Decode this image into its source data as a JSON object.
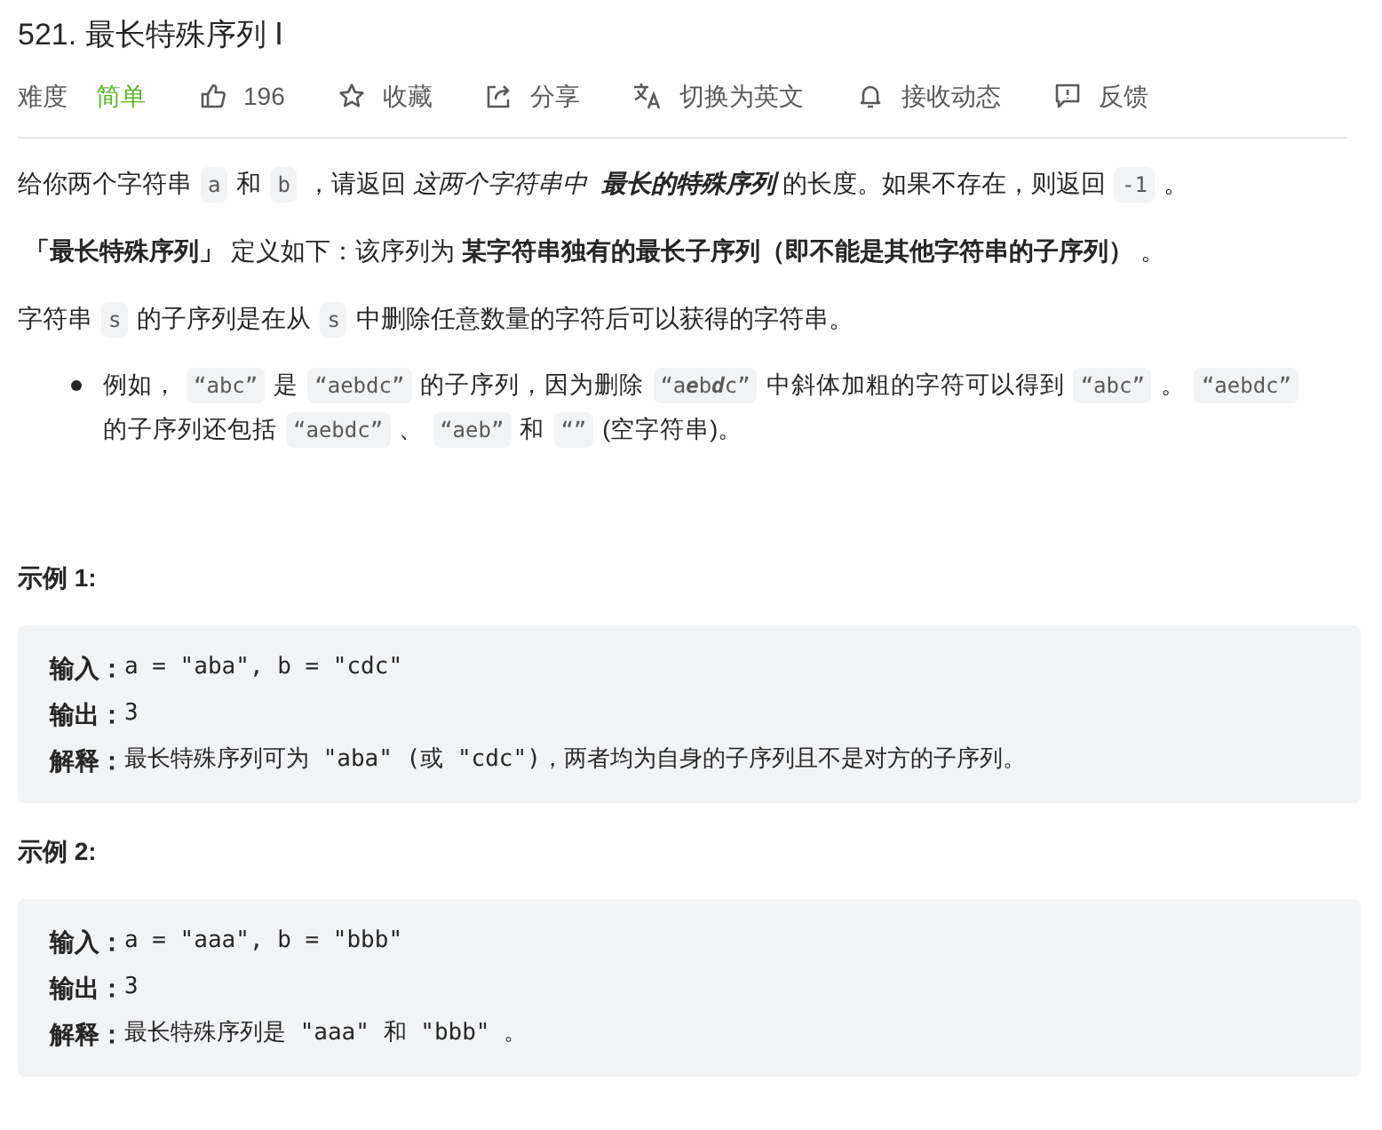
{
  "title": "521. 最长特殊序列 Ⅰ",
  "meta": {
    "difficulty_label": "难度",
    "difficulty": "简单",
    "actions": [
      {
        "kind": "like",
        "label": "196"
      },
      {
        "kind": "star",
        "label": "收藏"
      },
      {
        "kind": "share",
        "label": "分享"
      },
      {
        "kind": "translate",
        "label": "切换为英文"
      },
      {
        "kind": "bell",
        "label": "接收动态"
      },
      {
        "kind": "feedback",
        "label": "反馈"
      }
    ]
  },
  "paragraphs": [
    {
      "segments": [
        {
          "kind": "text",
          "text": "给你两个字符串"
        },
        {
          "kind": "code",
          "text": "a"
        },
        {
          "kind": "text",
          "text": "和"
        },
        {
          "kind": "code",
          "text": "b"
        },
        {
          "kind": "text",
          "text": "，请返回"
        },
        {
          "kind": "italic",
          "text": "这两个字符串中"
        },
        {
          "kind": "bold_italic",
          "text": "最长的特殊序列"
        },
        {
          "kind": "text",
          "text": "的长度。如果不存在，则返回"
        },
        {
          "kind": "code",
          "text": "-1"
        },
        {
          "kind": "text",
          "text": "。"
        }
      ]
    },
    {
      "segments": [
        {
          "kind": "bold",
          "text": "「最长特殊序列」"
        },
        {
          "kind": "text",
          "text": "定义如下：该序列为"
        },
        {
          "kind": "bold",
          "text": "某字符串独有的最长子序列（即不能是其他字符串的子序列）"
        },
        {
          "kind": "text",
          "text": "。"
        }
      ]
    },
    {
      "segments": [
        {
          "kind": "text",
          "text": "字符串"
        },
        {
          "kind": "code",
          "text": "s"
        },
        {
          "kind": "text",
          "text": "的子序列是在从"
        },
        {
          "kind": "code",
          "text": "s"
        },
        {
          "kind": "text",
          "text": "中删除任意数量的字符后可以获得的字符串。"
        }
      ]
    }
  ],
  "bullets": [
    {
      "segments": [
        {
          "kind": "text",
          "text": "例如，"
        },
        {
          "kind": "code",
          "text": "“abc”"
        },
        {
          "kind": "text",
          "text": "是"
        },
        {
          "kind": "code",
          "text": "“aebdc”"
        },
        {
          "kind": "text",
          "text": "的子序列，因为删除"
        },
        {
          "kind": "code",
          "parts": [
            {
              "text": "“a",
              "emphasis": false
            },
            {
              "text": "e",
              "emphasis": true
            },
            {
              "text": "b",
              "emphasis": false
            },
            {
              "text": "d",
              "emphasis": true
            },
            {
              "text": "c”",
              "emphasis": false
            }
          ]
        },
        {
          "kind": "text",
          "text": "中斜体加粗的字符可以得到"
        },
        {
          "kind": "code",
          "text": "“abc”"
        },
        {
          "kind": "text",
          "text": "。"
        },
        {
          "kind": "code",
          "text": "“aebdc”"
        },
        {
          "kind": "text",
          "text": "的子序列还包括"
        },
        {
          "kind": "code",
          "text": "“aebdc”"
        },
        {
          "kind": "text",
          "text": "、"
        },
        {
          "kind": "code",
          "text": "“aeb”"
        },
        {
          "kind": "text",
          "text": "和"
        },
        {
          "kind": "code",
          "text": "“”"
        },
        {
          "kind": "text",
          "text": "(空字符串)。"
        }
      ]
    }
  ],
  "examples": [
    {
      "heading": "示例 1:",
      "lines": [
        {
          "label": "输入：",
          "value": "a = \"aba\", b = \"cdc\""
        },
        {
          "label": "输出：",
          "value": "3"
        },
        {
          "label": "解释：",
          "value": "最长特殊序列可为 \"aba\" (或 \"cdc\")，两者均为自身的子序列且不是对方的子序列。"
        }
      ]
    },
    {
      "heading": "示例 2:",
      "lines": [
        {
          "label": "输入：",
          "value": "a = \"aaa\", b = \"bbb\""
        },
        {
          "label": "输出：",
          "value": "3"
        },
        {
          "label": "解释：",
          "value": "最长特殊序列是 \"aaa\" 和 \"bbb\" 。"
        }
      ]
    }
  ]
}
